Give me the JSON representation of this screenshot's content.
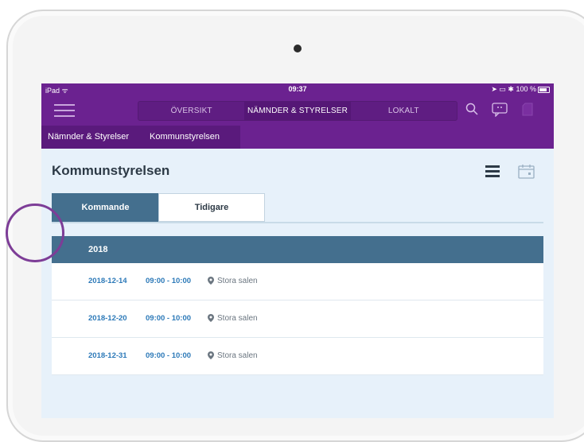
{
  "status": {
    "carrier": "iPad",
    "time": "09:37",
    "battery": "100 %"
  },
  "nav": {
    "tabs": [
      {
        "label": "ÖVERSIKT"
      },
      {
        "label": "NÄMNDER & STYRELSER"
      },
      {
        "label": "LOKALT"
      }
    ]
  },
  "breadcrumb": {
    "items": [
      "Nämnder & Styrelser",
      "Kommunstyrelsen"
    ]
  },
  "page": {
    "title": "Kommunstyrelsen"
  },
  "tabs": {
    "upcoming": "Kommande",
    "past": "Tidigare"
  },
  "group": {
    "year": "2018"
  },
  "meetings": [
    {
      "date": "2018-12-14",
      "time": "09:00 - 10:00",
      "location": "Stora salen"
    },
    {
      "date": "2018-12-20",
      "time": "09:00 - 10:00",
      "location": "Stora salen"
    },
    {
      "date": "2018-12-31",
      "time": "09:00 - 10:00",
      "location": "Stora salen"
    }
  ],
  "colors": {
    "brand": "#6b2290",
    "header_blue": "#446f8e",
    "link": "#2c79b8"
  }
}
